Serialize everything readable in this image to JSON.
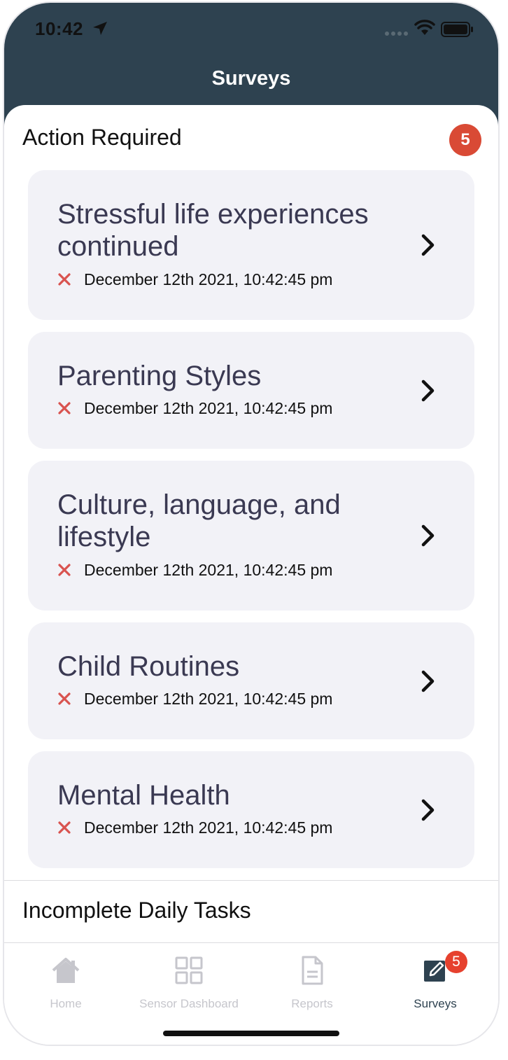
{
  "status_bar": {
    "time": "10:42"
  },
  "nav": {
    "title": "Surveys"
  },
  "action_required": {
    "heading": "Action Required",
    "count": "5",
    "items": [
      {
        "title": "Stressful life experiences continued",
        "date": "December 12th 2021, 10:42:45 pm"
      },
      {
        "title": "Parenting Styles",
        "date": "December 12th 2021, 10:42:45 pm"
      },
      {
        "title": "Culture, language, and lifestyle",
        "date": "December 12th 2021, 10:42:45 pm"
      },
      {
        "title": "Child Routines",
        "date": "December 12th 2021, 10:42:45 pm"
      },
      {
        "title": "Mental Health",
        "date": "December 12th 2021, 10:42:45 pm"
      }
    ]
  },
  "daily_tasks": {
    "heading": "Incomplete Daily Tasks"
  },
  "tabbar": {
    "tabs": [
      {
        "label": "Home",
        "icon": "home-icon"
      },
      {
        "label": "Sensor Dashboard",
        "icon": "grid-icon"
      },
      {
        "label": "Reports",
        "icon": "document-icon"
      },
      {
        "label": "Surveys",
        "icon": "edit-icon",
        "badge": "5"
      }
    ],
    "active": "Surveys"
  },
  "colors": {
    "header_bg": "#2e4250",
    "card_bg": "#f2f2f7",
    "badge_red": "#d94a35",
    "x_red": "#d9534f",
    "title_text": "#3a3952"
  }
}
